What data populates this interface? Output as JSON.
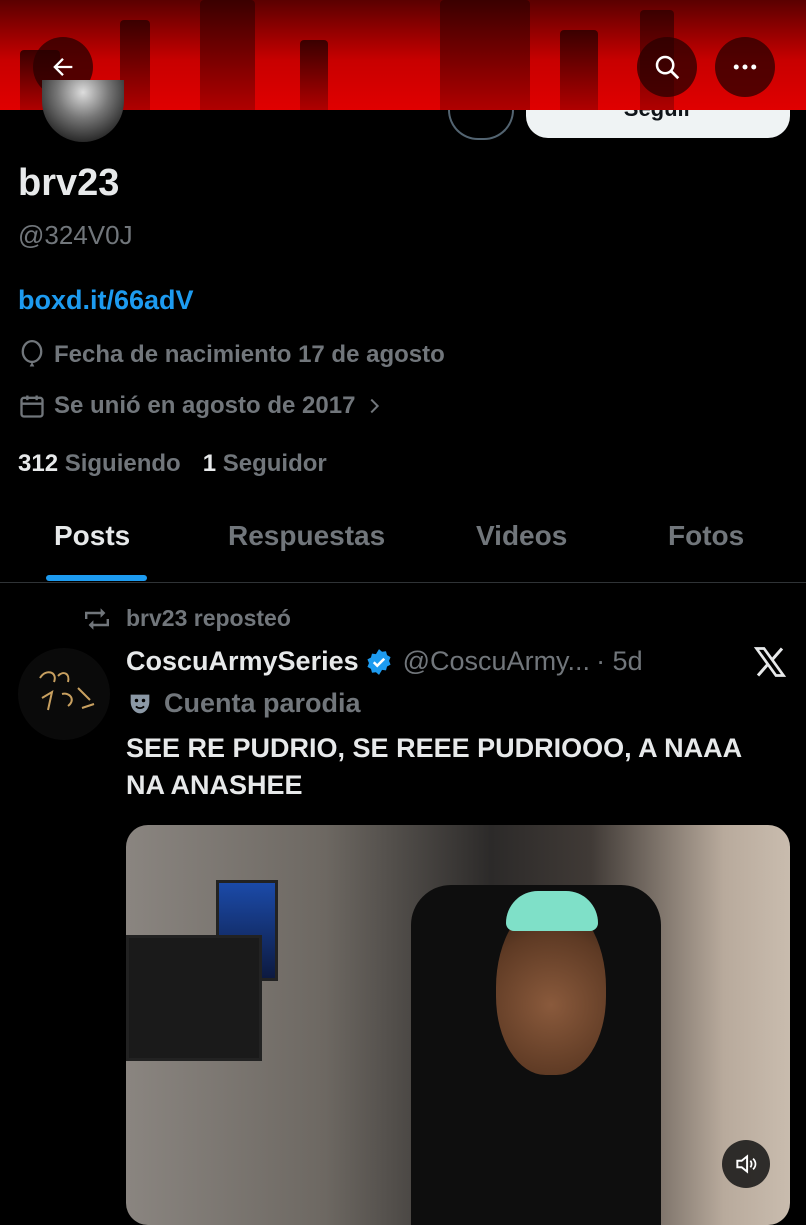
{
  "header": {
    "back_label": "Back",
    "follow_label": "Seguir"
  },
  "profile": {
    "display_name": "brv23",
    "handle": "@324V0J",
    "link": "boxd.it/66adV",
    "birthday": "Fecha de nacimiento 17 de agosto",
    "joined": "Se unió en agosto de 2017",
    "following_count": "312",
    "following_label": "Siguiendo",
    "followers_count": "1",
    "followers_label": "Seguidor"
  },
  "tabs": [
    {
      "label": "Posts",
      "active": true
    },
    {
      "label": "Respuestas",
      "active": false
    },
    {
      "label": "Videos",
      "active": false
    },
    {
      "label": "Fotos",
      "active": false
    }
  ],
  "post": {
    "repost_label": "brv23 reposteó",
    "author_name": "CoscuArmySeries",
    "author_handle": "@CoscuArmy...",
    "time": "· 5d",
    "parody_label": "Cuenta parodia",
    "text": "SEE RE PUDRIO, SE REEE PUDRIOOO, A NAAA NA ANASHEE"
  },
  "colors": {
    "accent": "#1d9bf0",
    "verified": "#1d9bf0",
    "banner_red": "#d00000"
  }
}
